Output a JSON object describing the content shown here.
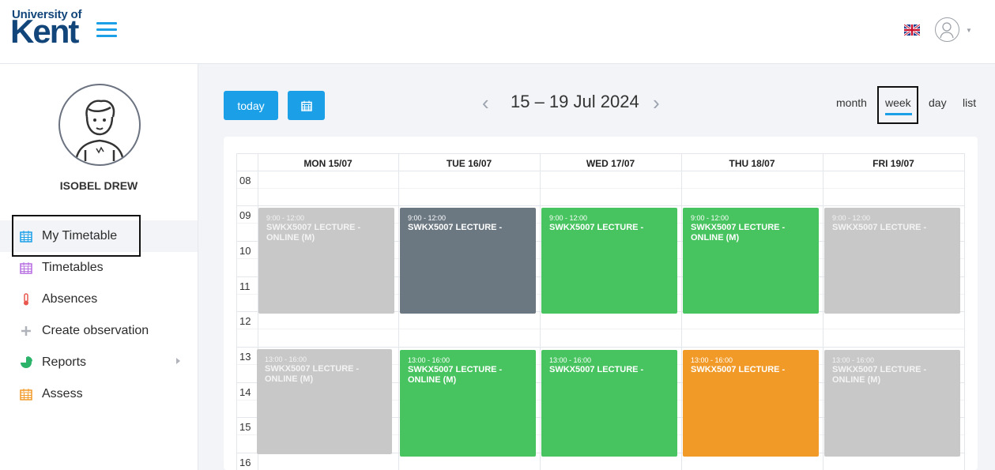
{
  "header": {
    "logo_small": "University of",
    "logo_big": "Kent",
    "flag_icon": "uk-flag-icon",
    "avatar_icon": "user-avatar-icon"
  },
  "profile": {
    "name": "ISOBEL DREW"
  },
  "sidebar": {
    "items": [
      {
        "label": "My Timetable",
        "icon": "calendar-icon",
        "color": "#1ba0e8"
      },
      {
        "label": "Timetables",
        "icon": "calendar-icon",
        "color": "#b56be0"
      },
      {
        "label": "Absences",
        "icon": "thermometer-icon",
        "color": "#e8584f"
      },
      {
        "label": "Create observation",
        "icon": "plus-icon",
        "color": "#b0b4ba"
      },
      {
        "label": "Reports",
        "icon": "pie-chart-icon",
        "color": "#2bb36a"
      },
      {
        "label": "Assess",
        "icon": "calendar-icon",
        "color": "#f19a27"
      }
    ]
  },
  "toolbar": {
    "today_label": "today",
    "date_range": "15 – 19 Jul 2024",
    "views": [
      "month",
      "week",
      "day",
      "list"
    ],
    "active_view": "week"
  },
  "calendar": {
    "days": [
      "MON 15/07",
      "TUE 16/07",
      "WED 17/07",
      "THU 18/07",
      "FRI 19/07"
    ],
    "hours": [
      "08",
      "09",
      "10",
      "11",
      "12",
      "13",
      "14",
      "15",
      "16"
    ],
    "events": {
      "mon_am": {
        "time": "9:00 - 12:00",
        "title": "SWKX5007 LECTURE - ONLINE (M)"
      },
      "tue_am": {
        "time": "9:00 - 12:00",
        "title": "SWKX5007 LECTURE -"
      },
      "wed_am": {
        "time": "9:00 - 12:00",
        "title": "SWKX5007 LECTURE -"
      },
      "thu_am": {
        "time": "9:00 - 12:00",
        "title": "SWKX5007 LECTURE - ONLINE (M)"
      },
      "fri_am": {
        "time": "9:00 - 12:00",
        "title": "SWKX5007 LECTURE -"
      },
      "mon_pm": {
        "time": "13:00 - 16:00",
        "title": "SWKX5007 LECTURE - ONLINE (M)"
      },
      "tue_pm": {
        "time": "13:00 - 16:00",
        "title": "SWKX5007 LECTURE - ONLINE (M)"
      },
      "wed_pm": {
        "time": "13:00 - 16:00",
        "title": "SWKX5007 LECTURE -"
      },
      "thu_pm": {
        "time": "13:00 - 16:00",
        "title": "SWKX5007 LECTURE -"
      },
      "fri_pm": {
        "time": "13:00 - 16:00",
        "title": "SWKX5007 LECTURE - ONLINE (M)"
      }
    }
  },
  "colors": {
    "accent": "#1ba0e8",
    "brand": "#12467a",
    "event_grey": "#c8c8c8",
    "event_slate": "#6b7882",
    "event_green": "#47c45f",
    "event_orange": "#f19a27"
  }
}
